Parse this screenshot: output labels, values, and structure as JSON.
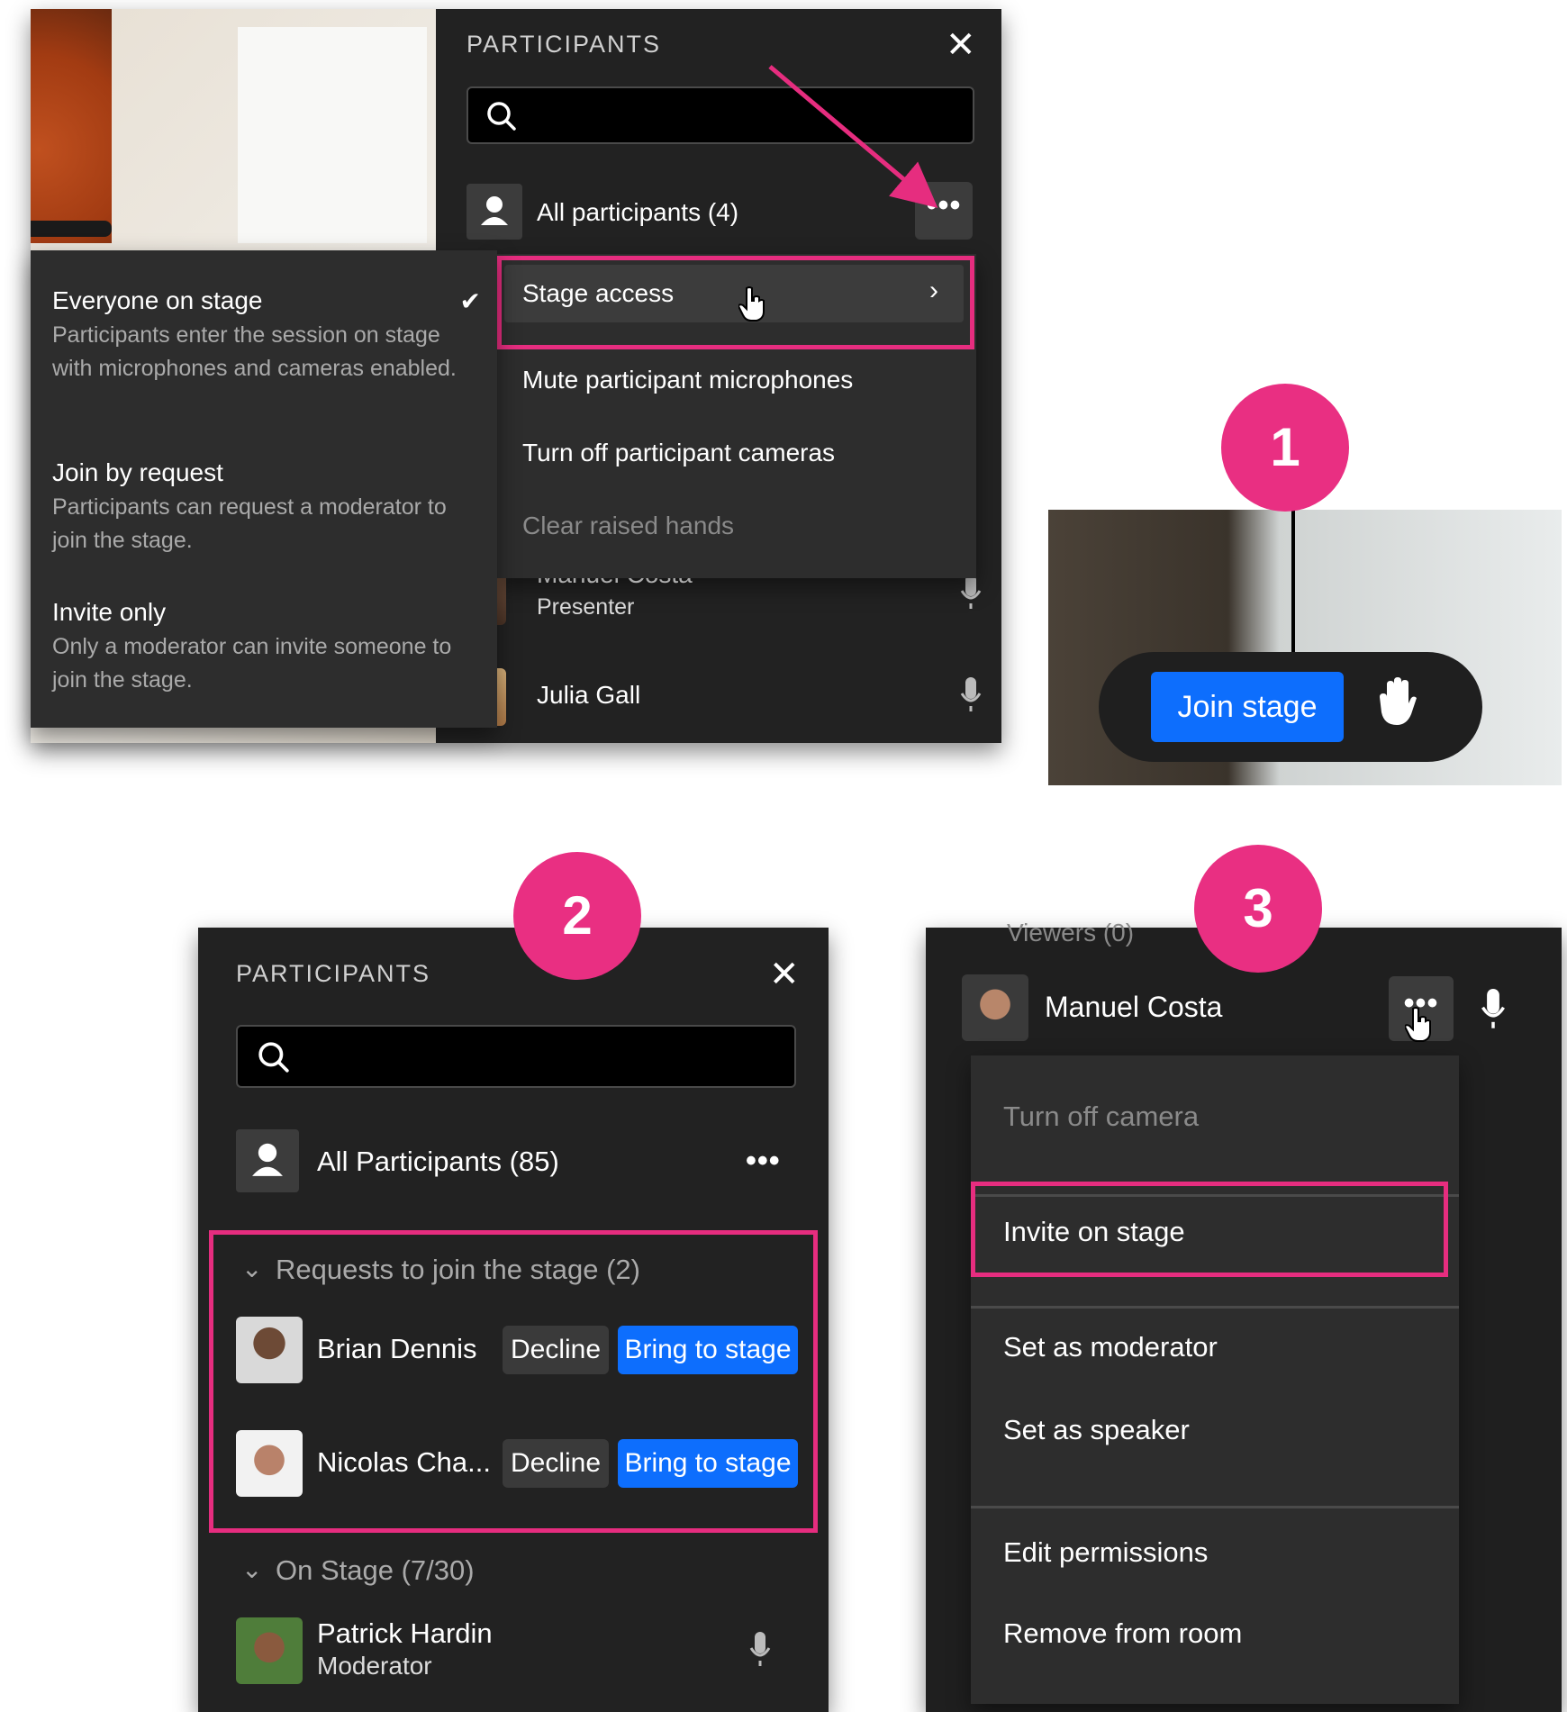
{
  "shot1": {
    "panel_title": "PARTICIPANTS",
    "all_participants": "All participants (4)",
    "menu": {
      "stage_access": "Stage access",
      "mute_mics": "Mute participant microphones",
      "turn_off_cams": "Turn off participant cameras",
      "clear_hands": "Clear raised hands"
    },
    "stage_options": [
      {
        "title": "Everyone on stage",
        "desc": "Participants enter the session on stage with microphones and cameras enabled.",
        "checked": true
      },
      {
        "title": "Join by request",
        "desc": "Participants can request a moderator to join the stage."
      },
      {
        "title": "Invite only",
        "desc": "Only a moderator can invite someone to join the stage."
      }
    ],
    "participants": [
      {
        "name": "Manuel Costa",
        "role": "Presenter"
      },
      {
        "name": "Julia Gall",
        "role": ""
      }
    ]
  },
  "badges": {
    "one": "1",
    "two": "2",
    "three": "3"
  },
  "shot_join": {
    "join_label": "Join stage"
  },
  "shot2": {
    "panel_title": "PARTICIPANTS",
    "all_participants": "All Participants (85)",
    "requests_header": "Requests to join the stage (2)",
    "requests": [
      {
        "name": "Brian Dennis",
        "decline": "Decline",
        "bring": "Bring to stage"
      },
      {
        "name": "Nicolas Cha...",
        "decline": "Decline",
        "bring": "Bring to stage"
      }
    ],
    "on_stage_header": "On Stage (7/30)",
    "on_stage": [
      {
        "name": "Patrick Hardin",
        "role": "Moderator"
      }
    ]
  },
  "shot3": {
    "viewers_header": "Viewers (0)",
    "name": "Manuel Costa",
    "menu": {
      "turn_off_camera": "Turn off camera",
      "invite_on_stage": "Invite on stage",
      "set_moderator": "Set as moderator",
      "set_speaker": "Set as speaker",
      "edit_permissions": "Edit permissions",
      "remove_from_room": "Remove from room"
    }
  },
  "colors": {
    "accent_pink": "#e62d7f",
    "button_blue": "#0d6efd",
    "panel_bg": "#222222"
  }
}
